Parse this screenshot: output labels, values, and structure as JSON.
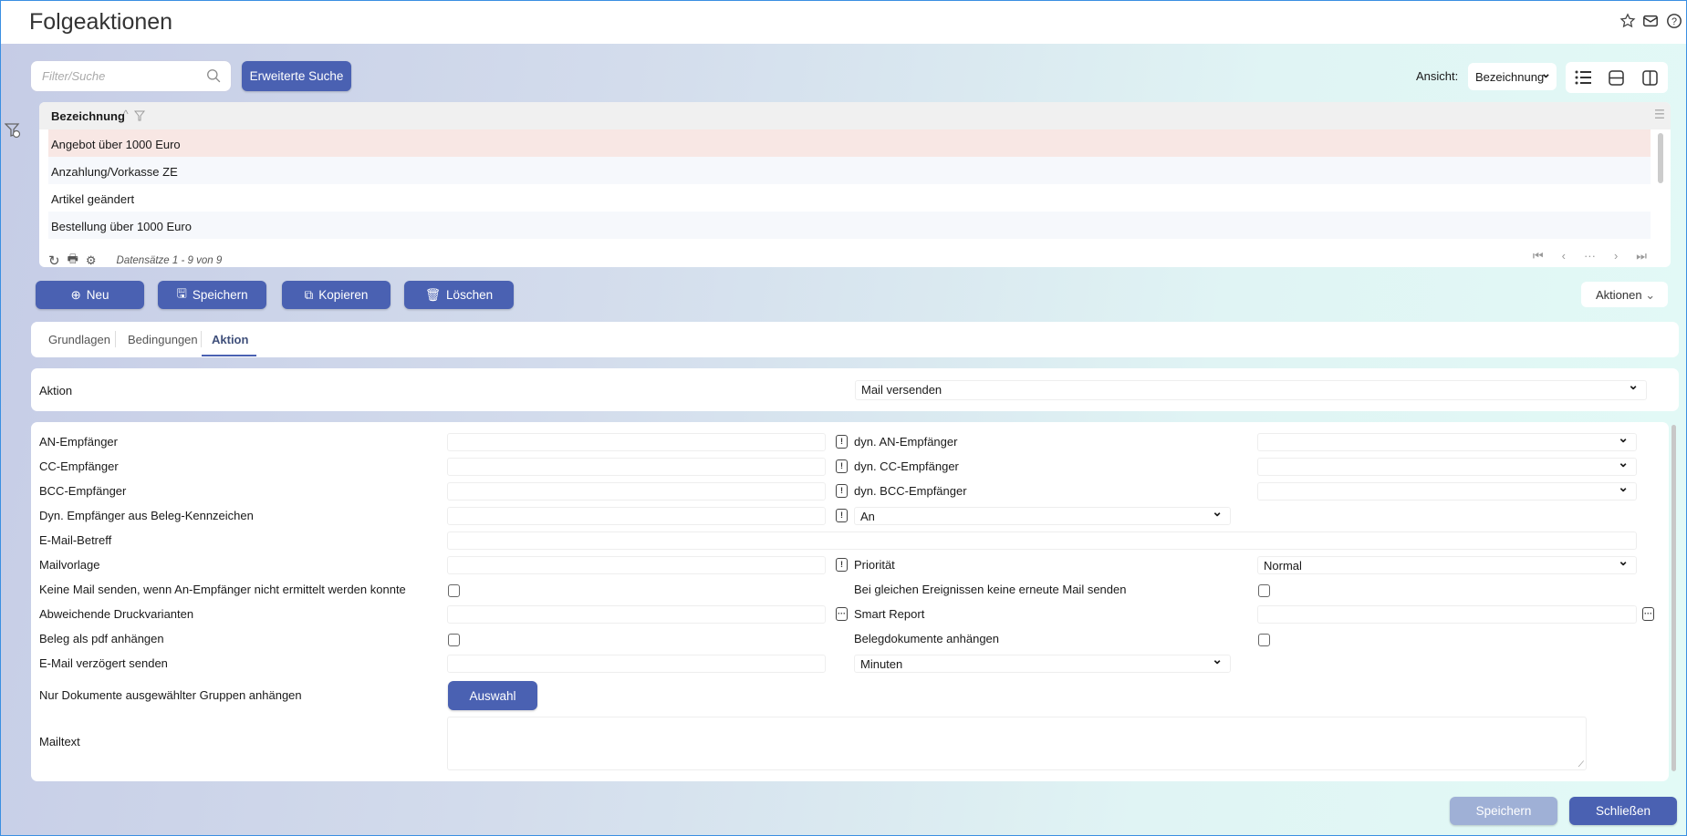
{
  "header": {
    "title": "Folgeaktionen"
  },
  "search": {
    "placeholder": "Filter/Suche",
    "advanced_label": "Erweiterte Suche"
  },
  "view": {
    "label": "Ansicht:",
    "selected": "Bezeichnung"
  },
  "grid": {
    "column": "Bezeichnung",
    "rows": [
      "Angebot über 1000 Euro",
      "Anzahlung/Vorkasse ZE",
      "Artikel geändert",
      "Bestellung über 1000 Euro"
    ],
    "status": "Datensätze 1 - 9 von 9"
  },
  "toolbar": {
    "new": "Neu",
    "save": "Speichern",
    "copy": "Kopieren",
    "delete": "Löschen",
    "actions": "Aktionen"
  },
  "tabs": [
    "Grundlagen",
    "Bedingungen",
    "Aktion"
  ],
  "action": {
    "label": "Aktion",
    "value": "Mail versenden"
  },
  "form": {
    "an": "AN-Empfänger",
    "cc": "CC-Empfänger",
    "bcc": "BCC-Empfänger",
    "dyn_beleg": "Dyn. Empfänger aus Beleg-Kennzeichen",
    "betreff": "E-Mail-Betreff",
    "vorlage": "Mailvorlage",
    "keine_mail": "Keine Mail senden, wenn An-Empfänger nicht ermittelt werden konnte",
    "druck": "Abweichende Druckvarianten",
    "pdf": "Beleg als pdf anhängen",
    "verzoegert": "E-Mail verzögert senden",
    "nur_dok": "Nur Dokumente ausgewählter Gruppen anhängen",
    "mailtext": "Mailtext",
    "dyn_an": "dyn. AN-Empfänger",
    "dyn_cc": "dyn. CC-Empfänger",
    "dyn_bcc": "dyn. BCC-Empfänger",
    "dyn_beleg_value": "An",
    "prio": "Priorität",
    "prio_value": "Normal",
    "gleiche": "Bei gleichen Ereignissen keine erneute Mail senden",
    "smart": "Smart Report",
    "belegdok": "Belegdokumente anhängen",
    "unit_value": "Minuten",
    "auswahl": "Auswahl"
  },
  "footer": {
    "save": "Speichern",
    "close": "Schließen"
  },
  "colors": {
    "primary": "#4a61b2",
    "selected_row": "#f8e7e4"
  }
}
